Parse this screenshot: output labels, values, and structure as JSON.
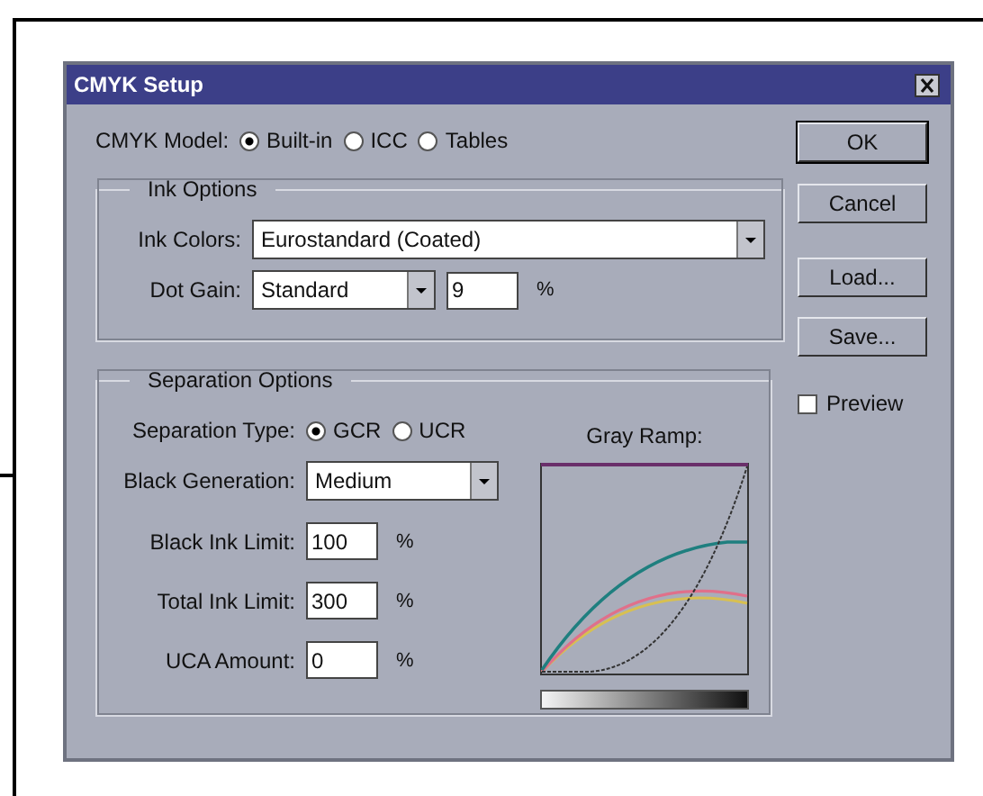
{
  "window": {
    "title": "CMYK Setup"
  },
  "cmyk_model": {
    "label": "CMYK Model:",
    "options": [
      {
        "label": "Built-in",
        "selected": true
      },
      {
        "label": "ICC",
        "selected": false
      },
      {
        "label": "Tables",
        "selected": false
      }
    ]
  },
  "ink_options": {
    "title": "Ink Options",
    "ink_colors": {
      "label": "Ink Colors:",
      "value": "Eurostandard (Coated)"
    },
    "dot_gain": {
      "label": "Dot Gain:",
      "value": "Standard",
      "amount": "9",
      "unit": "%"
    }
  },
  "separation_options": {
    "title": "Separation Options",
    "separation_type": {
      "label": "Separation Type:",
      "options": [
        {
          "label": "GCR",
          "selected": true
        },
        {
          "label": "UCR",
          "selected": false
        }
      ]
    },
    "black_generation": {
      "label": "Black Generation:",
      "value": "Medium"
    },
    "limits": [
      {
        "label": "Black Ink Limit:",
        "value": "100",
        "unit": "%"
      },
      {
        "label": "Total Ink Limit:",
        "value": "300",
        "unit": "%"
      },
      {
        "label": "UCA Amount:",
        "value": "0",
        "unit": "%"
      }
    ],
    "gray_ramp": {
      "label": "Gray Ramp:"
    }
  },
  "buttons": [
    "OK",
    "Cancel",
    "Load...",
    "Save..."
  ],
  "preview": {
    "label": "Preview",
    "checked": false
  }
}
